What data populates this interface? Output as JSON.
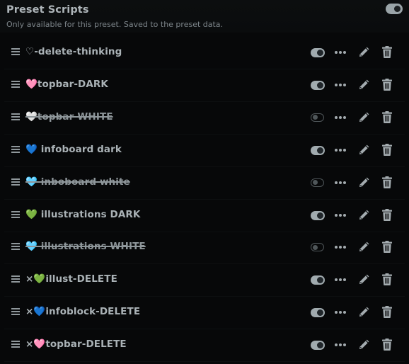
{
  "header": {
    "title": "Preset Scripts",
    "subtitle": "Only available for this preset. Saved to the preset data.",
    "enabled": true
  },
  "colors": {
    "background": "#070809",
    "text": "#aab2b6",
    "toggle_on": "#a1abaf",
    "toggle_off": "#4f5659"
  },
  "scripts": [
    {
      "name": "♡-delete-thinking",
      "enabled": true
    },
    {
      "name": "🩷topbar-DARK",
      "enabled": true
    },
    {
      "name": "🤍topbar-WHITE",
      "enabled": false
    },
    {
      "name": "💙 infoboard dark",
      "enabled": true
    },
    {
      "name": "🩵 inboboard white",
      "enabled": false
    },
    {
      "name": "💚 illustrations DARK",
      "enabled": true
    },
    {
      "name": "🩵 illustrations WHITE",
      "enabled": false
    },
    {
      "name": "×💚illust-DELETE",
      "enabled": true
    },
    {
      "name": "×💙infoblock-DELETE",
      "enabled": true
    },
    {
      "name": "×🩷topbar-DELETE",
      "enabled": true
    }
  ],
  "icons": {
    "drag": "drag-handle-icon",
    "toggle": "toggle-icon",
    "more": "more-options-icon",
    "edit": "pencil-icon",
    "delete": "trash-icon"
  }
}
